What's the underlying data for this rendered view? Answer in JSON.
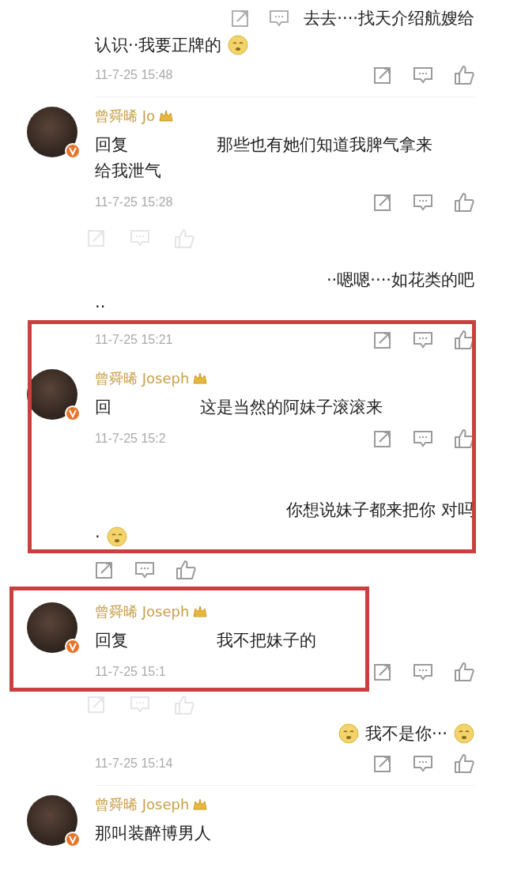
{
  "entries": [
    {
      "kind": "line_right",
      "text": "去去····找天介绍航嫂给",
      "icons_before": true
    },
    {
      "kind": "line_left",
      "text": "认识··我要正牌的",
      "emoji_after": true
    },
    {
      "kind": "meta",
      "time": "11-7-25 15:48"
    },
    {
      "kind": "divider"
    },
    {
      "kind": "comment",
      "name": "曾舜晞 Jo",
      "reply_label": "回复",
      "text": "那些也有她们知道我脾气拿来给我泄气",
      "time": "11-7-25 15:28"
    },
    {
      "kind": "faded_actions"
    },
    {
      "kind": "line_right",
      "text": "··嗯嗯····如花类的吧"
    },
    {
      "kind": "line_left",
      "text": "··"
    },
    {
      "kind": "wide_box",
      "entries": [
        {
          "kind": "meta",
          "time": "11-7-25 15:21"
        },
        {
          "kind": "comment",
          "name": "曾舜晞 Joseph",
          "reply_label": "回",
          "text": "这是当然的阿妹子滚滚来",
          "time": "11-7-25 15:2"
        },
        {
          "kind": "line_right",
          "text": "你想说妹子都来把你 对吗"
        },
        {
          "kind": "line_left",
          "text": "·",
          "emoji_after": true
        }
      ]
    },
    {
      "kind": "meta"
    },
    {
      "kind": "narrow_box",
      "entries": [
        {
          "kind": "comment",
          "name": "曾舜晞 Joseph",
          "reply_label": "回复",
          "text": "我不把妹子的",
          "time": "11-7-25 15:1"
        }
      ]
    },
    {
      "kind": "faded_actions"
    },
    {
      "kind": "line_right",
      "text": "我不是你···",
      "emoji_before": true,
      "emoji_after": true
    },
    {
      "kind": "meta",
      "time": "11-7-25 15:14"
    },
    {
      "kind": "divider"
    },
    {
      "kind": "comment",
      "name": "曾舜晞 Joseph",
      "text": "那叫装醉博男人"
    }
  ]
}
